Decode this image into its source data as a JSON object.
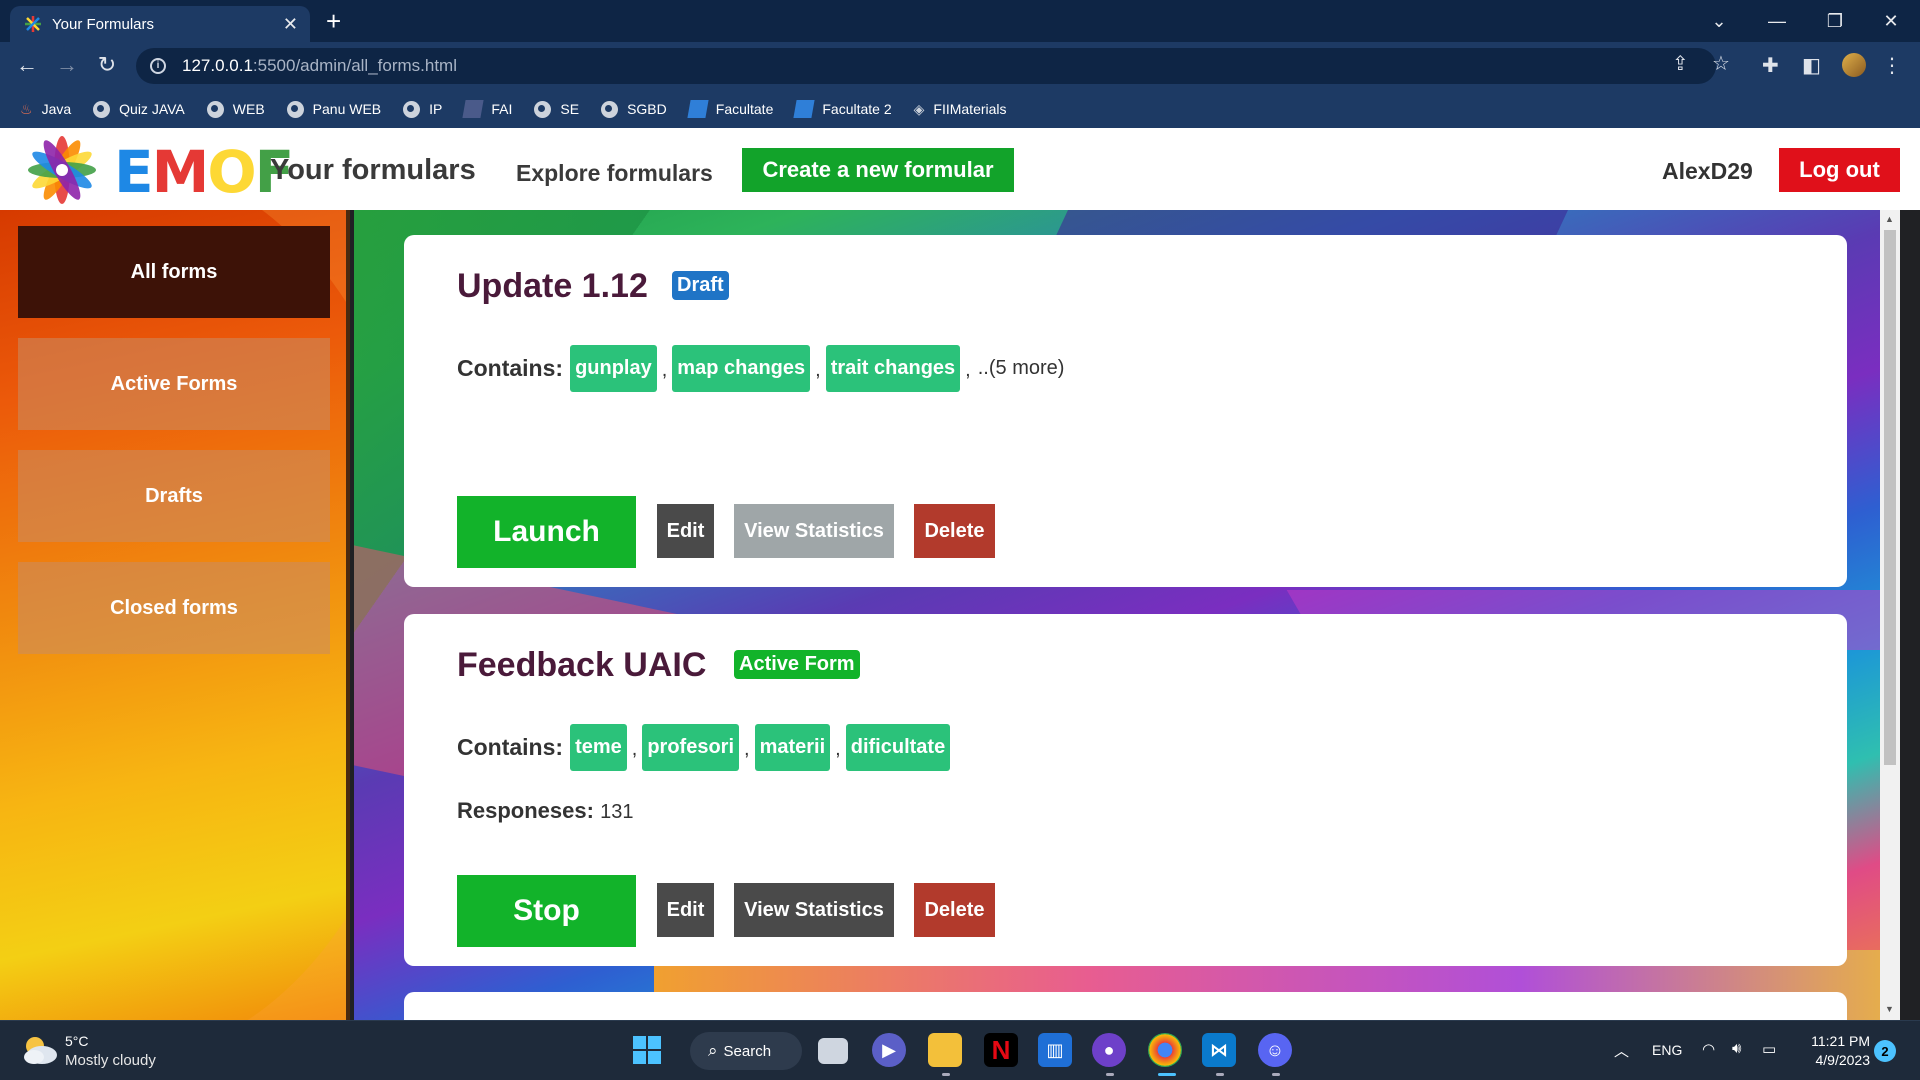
{
  "browser": {
    "tab_title": "Your Formulars",
    "url_host": "127.0.0.1",
    "url_path": ":5500/admin/all_forms.html",
    "bookmarks": [
      "Java",
      "Quiz JAVA",
      "WEB",
      "Panu WEB",
      "IP",
      "FAI",
      "SE",
      "SGBD",
      "Facultate",
      "Facultate 2",
      "FIIMaterials"
    ]
  },
  "header": {
    "logo_text": "EMOF",
    "nav_your": "Your formulars",
    "nav_explore": "Explore formulars",
    "create_label": "Create a new formular",
    "username": "AlexD29",
    "logout_label": "Log out"
  },
  "sidebar": {
    "items": [
      {
        "label": "All forms",
        "active": true
      },
      {
        "label": "Active Forms",
        "active": false
      },
      {
        "label": "Drafts",
        "active": false
      },
      {
        "label": "Closed forms",
        "active": false
      }
    ]
  },
  "forms": [
    {
      "title": "Update 1.12",
      "status": "Draft",
      "contains_label": "Contains:",
      "tags": [
        "gunplay",
        "map changes",
        "trait changes"
      ],
      "more": "..(5 more)",
      "primary_action": "Launch",
      "edit_label": "Edit",
      "stats_label": "View Statistics",
      "delete_label": "Delete"
    },
    {
      "title": "Feedback UAIC",
      "status": "Active Form",
      "contains_label": "Contains:",
      "tags": [
        "teme",
        "profesori",
        "materii",
        "dificultate"
      ],
      "responses_label": "Responeses:",
      "responses_value": "131",
      "primary_action": "Stop",
      "edit_label": "Edit",
      "stats_label": "View Statistics",
      "delete_label": "Delete"
    }
  ],
  "taskbar": {
    "temperature": "5°C",
    "weather": "Mostly cloudy",
    "search_label": "Search",
    "language": "ENG",
    "time": "11:21 PM",
    "date": "4/9/2023",
    "notifications": "2"
  },
  "colors": {
    "create_button": "#12a32a",
    "logout_button": "#e0101a",
    "tag": "#2bc27a",
    "draft_badge": "#1f74c6",
    "active_badge": "#12b32a",
    "delete_button": "#b23a2c"
  }
}
